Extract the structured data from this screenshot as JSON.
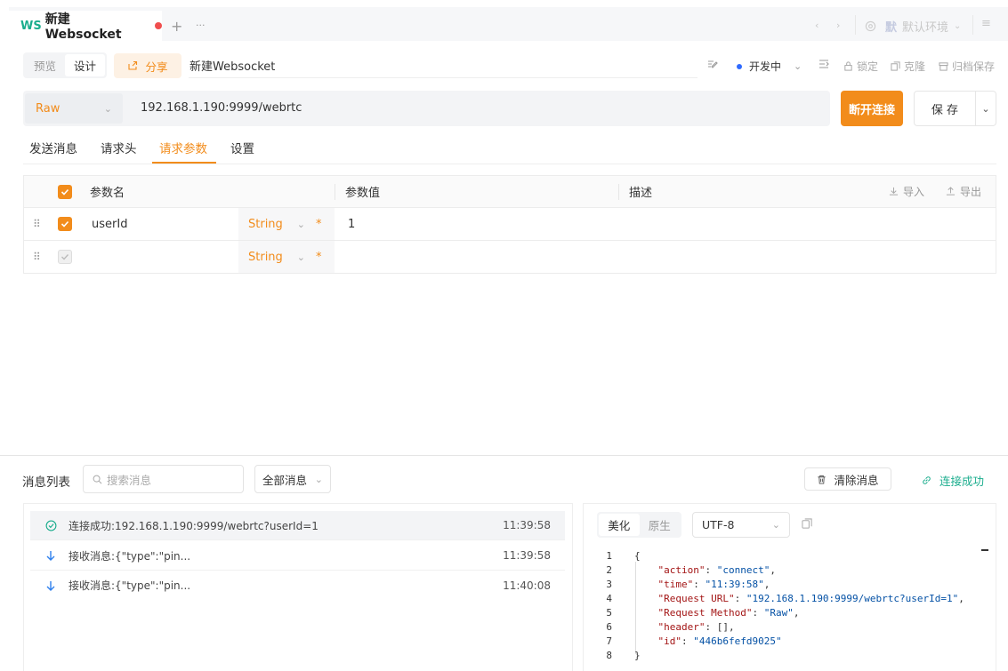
{
  "tabs": {
    "active": {
      "badge": "WS",
      "title": "新建Websocket"
    },
    "add_label": "+",
    "more_label": "···",
    "env_label": "默认环境",
    "env_badge": "默"
  },
  "toolbar": {
    "preview_label": "预览",
    "design_label": "设计",
    "share_label": "分享",
    "doc_title": "新建Websocket",
    "status_label": "开发中",
    "lock_label": "锁定",
    "clone_label": "克隆",
    "archive_label": "归档保存",
    "colors": {
      "accent": "#f28c1b",
      "ws_badge": "#1aad8d",
      "status_dot": "#2f6bff",
      "unsaved_dot": "#f04e4e"
    }
  },
  "request": {
    "method": "Raw",
    "url": "192.168.1.190:9999/webrtc",
    "disconnect_label": "断开连接",
    "save_label": "保 存"
  },
  "subtabs": [
    "发送消息",
    "请求头",
    "请求参数",
    "设置"
  ],
  "params": {
    "headers": {
      "name": "参数名",
      "value": "参数值",
      "desc": "描述",
      "import": "导入",
      "export": "导出"
    },
    "rows": [
      {
        "checked": true,
        "name": "userId",
        "type": "String",
        "value": "1"
      },
      {
        "checked": true,
        "name": "",
        "type": "String",
        "value": ""
      }
    ],
    "required_mark": "*"
  },
  "messages": {
    "title": "消息列表",
    "search_placeholder": "搜索消息",
    "filter_label": "全部消息",
    "clear_label": "清除消息",
    "status_label": "连接成功",
    "items": [
      {
        "icon": "check-circle-icon",
        "text": "连接成功:192.168.1.190:9999/webrtc?userId=1",
        "time": "11:39:58",
        "selected": true
      },
      {
        "icon": "arrow-down-icon",
        "text": "接收消息:{\"type\":\"pin...",
        "time": "11:39:58",
        "selected": false
      },
      {
        "icon": "arrow-down-icon",
        "text": "接收消息:{\"type\":\"pin...",
        "time": "11:40:08",
        "selected": false
      }
    ]
  },
  "detail": {
    "pretty_label": "美化",
    "raw_label": "原生",
    "encoding": "UTF-8",
    "lines": [
      {
        "n": "1",
        "text": "{"
      },
      {
        "n": "2",
        "key": "\"action\"",
        "val": "\"connect\"",
        "tail": ","
      },
      {
        "n": "3",
        "key": "\"time\"",
        "val": "\"11:39:58\"",
        "tail": ","
      },
      {
        "n": "4",
        "key": "\"Request URL\"",
        "val": "\"192.168.1.190:9999/webrtc?userId=1\"",
        "tail": ","
      },
      {
        "n": "5",
        "key": "\"Request Method\"",
        "val": "\"Raw\"",
        "tail": ","
      },
      {
        "n": "6",
        "key": "\"header\"",
        "val": "[]",
        "tail": ","
      },
      {
        "n": "7",
        "key": "\"id\"",
        "val": "\"446b6fefd9025\"",
        "tail": ""
      },
      {
        "n": "8",
        "text": "}"
      }
    ]
  }
}
